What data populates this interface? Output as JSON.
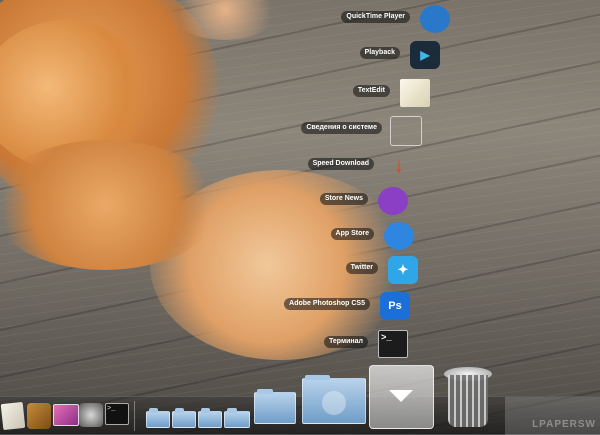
{
  "stack": {
    "items": [
      {
        "label": "QuickTime Player",
        "icon": "quicktime-icon",
        "color": "#2a78c9"
      },
      {
        "label": "Playback",
        "icon": "playback-icon",
        "color": "#1b2b3a"
      },
      {
        "label": "TextEdit",
        "icon": "textedit-icon",
        "color": "#e8e2cf"
      },
      {
        "label": "Сведения о системе",
        "icon": "system-info-icon",
        "color": "#9aa0a6"
      },
      {
        "label": "Speed Download",
        "icon": "speed-download-icon",
        "color": "#e0401a"
      },
      {
        "label": "Store News",
        "icon": "store-news-icon",
        "color": "#8a3fc4"
      },
      {
        "label": "App Store",
        "icon": "app-store-icon",
        "color": "#2f86e0"
      },
      {
        "label": "Twitter",
        "icon": "twitter-icon",
        "color": "#2ea6e8"
      },
      {
        "label": "Adobe Photoshop CS5",
        "icon": "photoshop-icon",
        "color": "#1b6fd6"
      },
      {
        "label": "Терминал",
        "icon": "terminal-icon",
        "color": "#1c1c1c"
      }
    ]
  },
  "dock": {
    "apps": [
      {
        "icon": "preview-icon"
      },
      {
        "icon": "tools-icon"
      },
      {
        "icon": "display-icon"
      },
      {
        "icon": "system-preferences-icon"
      },
      {
        "icon": "terminal-icon"
      }
    ],
    "trash_icon": "trash-icon",
    "stack_arrow_icon": "chevron-down-icon"
  },
  "watermark": "LPAPERSW"
}
